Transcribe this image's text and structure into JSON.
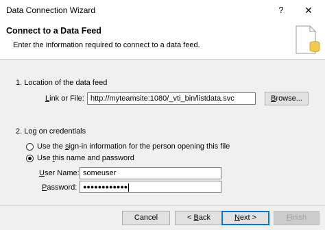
{
  "window": {
    "title": "Data Connection Wizard",
    "help_glyph": "?",
    "close_glyph": "✕"
  },
  "header": {
    "title": "Connect to a Data Feed",
    "subtitle": "Enter the information required to connect to a data feed.",
    "icon": "data-feed-document-icon"
  },
  "location": {
    "section_label": "1. Location of the data feed",
    "link_label_prefix": "",
    "link_label_mnemonic": "L",
    "link_label_rest": "ink or File:",
    "link_value": "http://myteamsite:1080/_vti_bin/listdata.svc",
    "browse_mnemonic": "B",
    "browse_rest": "rowse..."
  },
  "credentials": {
    "section_label": "2. Log on credentials",
    "option1_before": "Use the ",
    "option1_mnemonic": "s",
    "option1_after": "ign-in information for the person opening this file",
    "option1_selected": false,
    "option2_before": "Use ",
    "option2_mnemonic": "t",
    "option2_after": "his name and password",
    "option2_selected": true,
    "username_mnemonic": "U",
    "username_rest": "ser Name:",
    "username_value": "someuser",
    "password_mnemonic": "P",
    "password_rest": "assword:",
    "password_value": "●●●●●●●●●●●●"
  },
  "footer": {
    "cancel_label": "Cancel",
    "back_prefix": "< ",
    "back_mnemonic": "B",
    "back_rest": "ack",
    "next_mnemonic": "N",
    "next_rest": "ext >",
    "finish_mnemonic": "F",
    "finish_rest": "inish"
  }
}
